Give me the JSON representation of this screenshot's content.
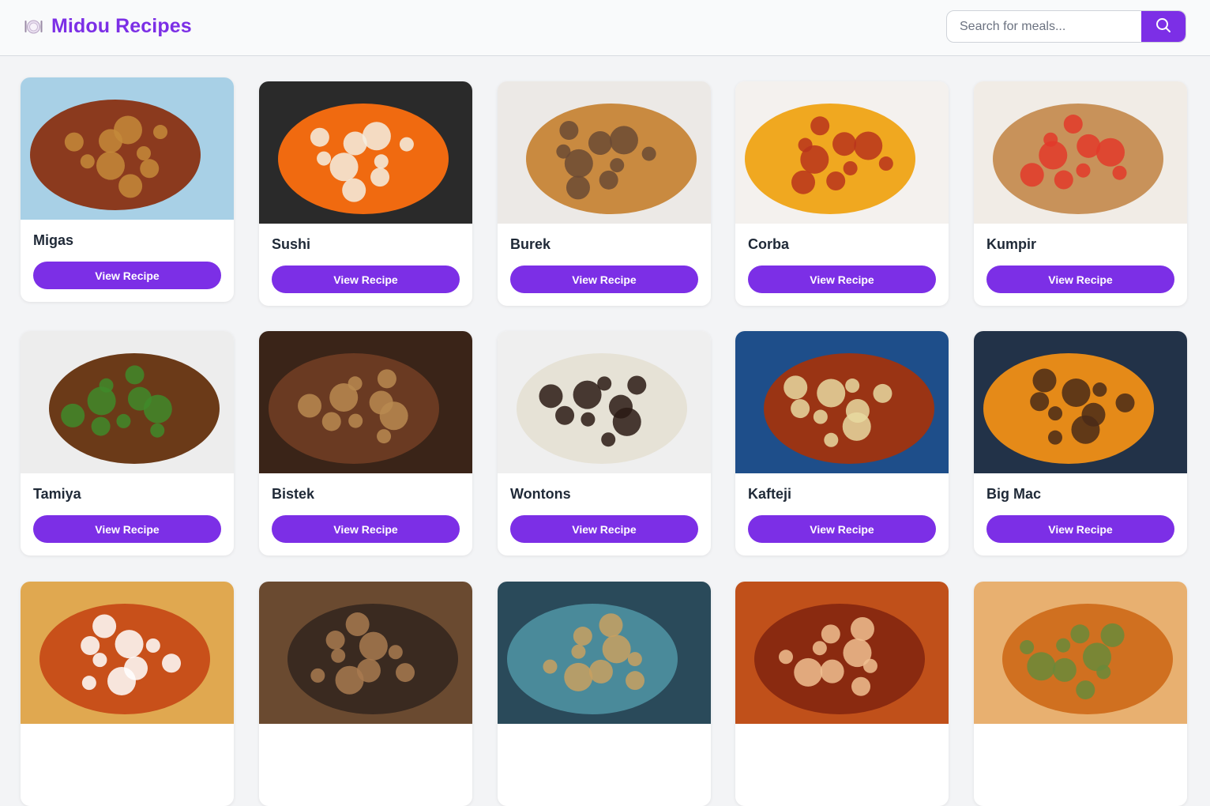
{
  "header": {
    "brand_icon": "plate-cutlery-icon",
    "title": "Midou Recipes",
    "search_placeholder": "Search for meals...",
    "search_icon": "search-icon"
  },
  "colors": {
    "accent": "#7c2fe6",
    "page_bg": "#f3f4f6",
    "header_bg": "#f9fafb"
  },
  "button_label": "View Recipe",
  "meals": [
    {
      "name": "Migas",
      "image": "migas-bowl-photo",
      "palette": [
        "#a8d0e6",
        "#8b3a1e",
        "#c48a3a"
      ]
    },
    {
      "name": "Sushi",
      "image": "sushi-rolls-photo",
      "palette": [
        "#2a2a2a",
        "#f06a10",
        "#f5efe2"
      ]
    },
    {
      "name": "Burek",
      "image": "burek-pastry-photo",
      "palette": [
        "#ece9e6",
        "#c98a40",
        "#6b4a34"
      ]
    },
    {
      "name": "Corba",
      "image": "corba-soup-photo",
      "palette": [
        "#f4f1ee",
        "#f0a820",
        "#b8341c"
      ]
    },
    {
      "name": "Kumpir",
      "image": "kumpir-potato-photo",
      "palette": [
        "#f1ece6",
        "#c8925a",
        "#e23a2a"
      ]
    },
    {
      "name": "Tamiya",
      "image": "tamiya-falafel-photo",
      "palette": [
        "#ededed",
        "#6b3a18",
        "#3f8a2a"
      ]
    },
    {
      "name": "Bistek",
      "image": "bistek-beef-onions-photo",
      "palette": [
        "#3a2418",
        "#6a3a22",
        "#b88a50"
      ]
    },
    {
      "name": "Wontons",
      "image": "wontons-dumplings-photo",
      "palette": [
        "#efefef",
        "#e6e2d6",
        "#2a1a14"
      ]
    },
    {
      "name": "Kafteji",
      "image": "kafteji-plate-photo",
      "palette": [
        "#1e4e8a",
        "#9a3414",
        "#e8d9a0"
      ]
    },
    {
      "name": "Big Mac",
      "image": "big-mac-burger-photo",
      "palette": [
        "#223248",
        "#e58a18",
        "#4a2a18"
      ]
    },
    {
      "name": "",
      "image": "partial-meal-photo-1",
      "palette": [
        "#e0a850",
        "#c8501a",
        "#ffffff"
      ]
    },
    {
      "name": "",
      "image": "partial-meal-photo-2",
      "palette": [
        "#6a4a30",
        "#3a2a20",
        "#a87a50"
      ]
    },
    {
      "name": "",
      "image": "partial-meal-photo-3",
      "palette": [
        "#2a4a5a",
        "#4a8a9a",
        "#c8a060"
      ]
    },
    {
      "name": "",
      "image": "partial-meal-photo-4",
      "palette": [
        "#c0501a",
        "#8a2a10",
        "#f0c090"
      ]
    },
    {
      "name": "",
      "image": "partial-meal-photo-5",
      "palette": [
        "#e8b070",
        "#d07020",
        "#6a8a3a"
      ]
    }
  ]
}
